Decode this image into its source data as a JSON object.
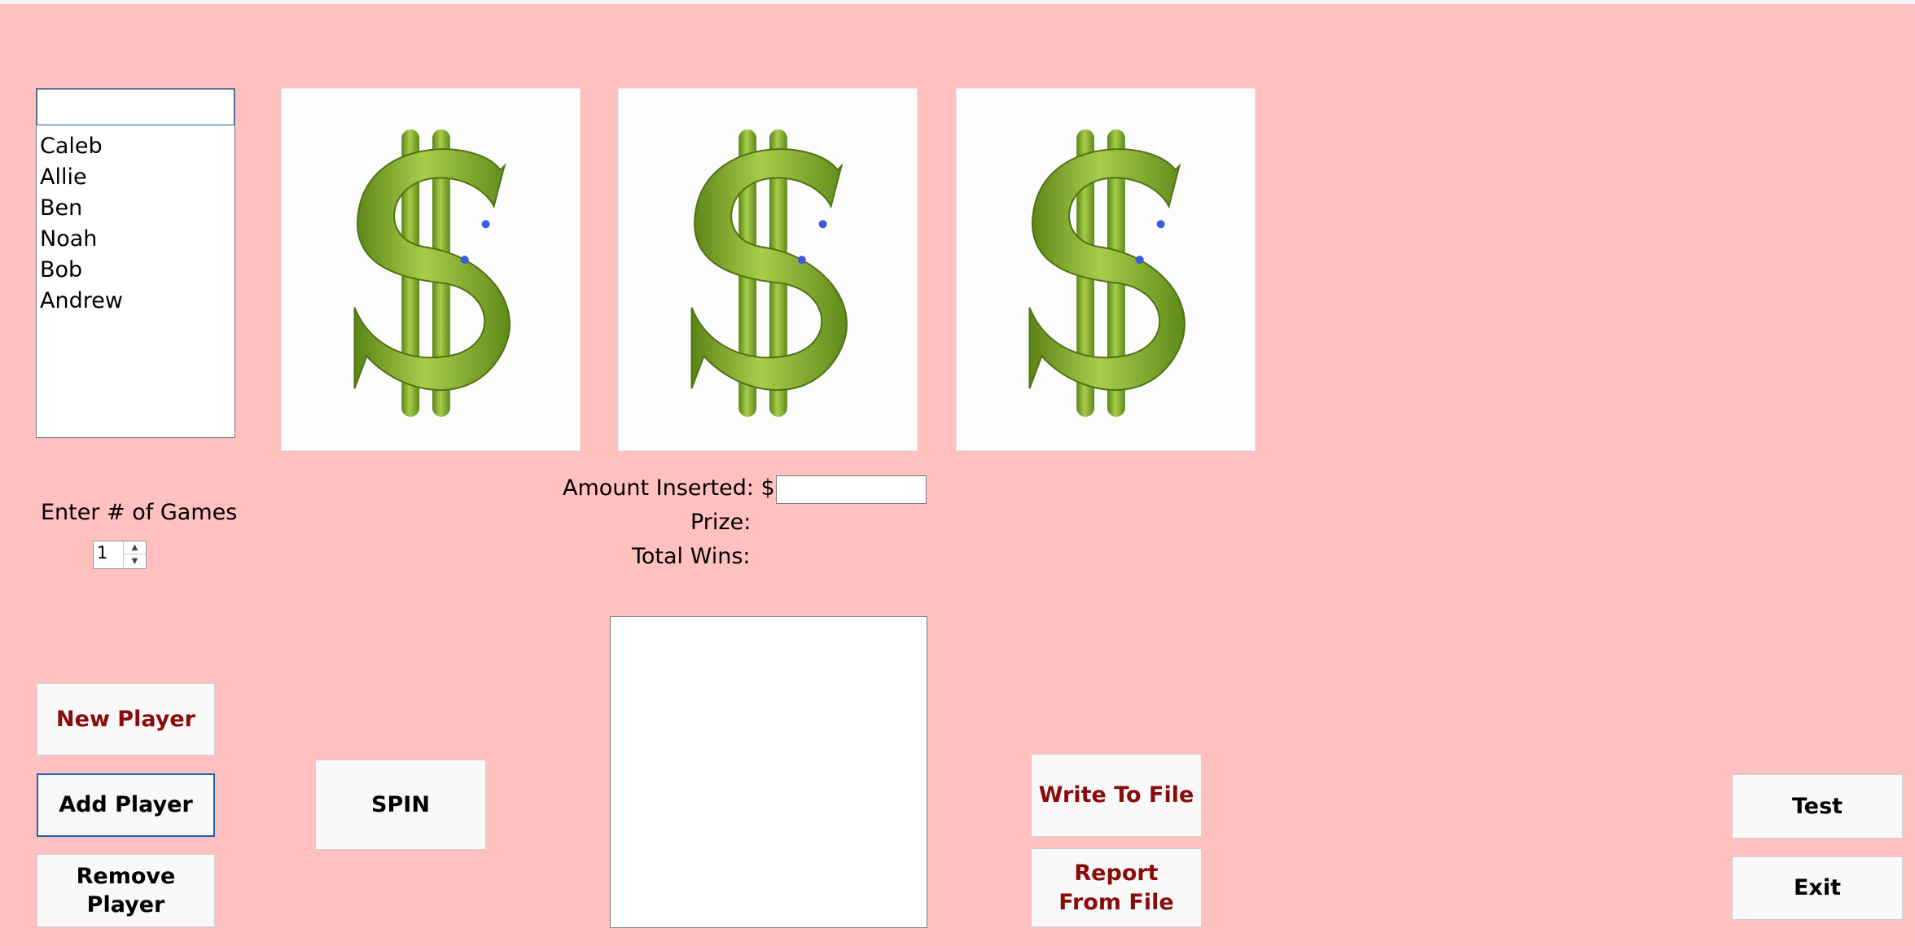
{
  "players": {
    "input_value": "",
    "items": [
      "Caleb",
      "Allie",
      "Ben",
      "Noah",
      "Bob",
      "Andrew"
    ]
  },
  "games": {
    "label": "Enter # of Games",
    "value": "1"
  },
  "reels": [
    {
      "symbol": "dollar-sign"
    },
    {
      "symbol": "dollar-sign"
    },
    {
      "symbol": "dollar-sign"
    }
  ],
  "info": {
    "amount_label": "Amount Inserted: $",
    "amount_value": "",
    "prize_label": "Prize:",
    "total_wins_label": "Total Wins:"
  },
  "buttons": {
    "new_player": "New Player",
    "add_player": "Add Player",
    "remove_player": "Remove Player",
    "spin": "SPIN",
    "write_to_file": "Write To File",
    "report_from_file": "Report From File",
    "test": "Test",
    "exit": "Exit"
  },
  "colors": {
    "background": "#ffc0c0",
    "accent_text": "#8b0a0a",
    "focus_border": "#1e62b8",
    "dollar_green": "#7fa62a"
  }
}
